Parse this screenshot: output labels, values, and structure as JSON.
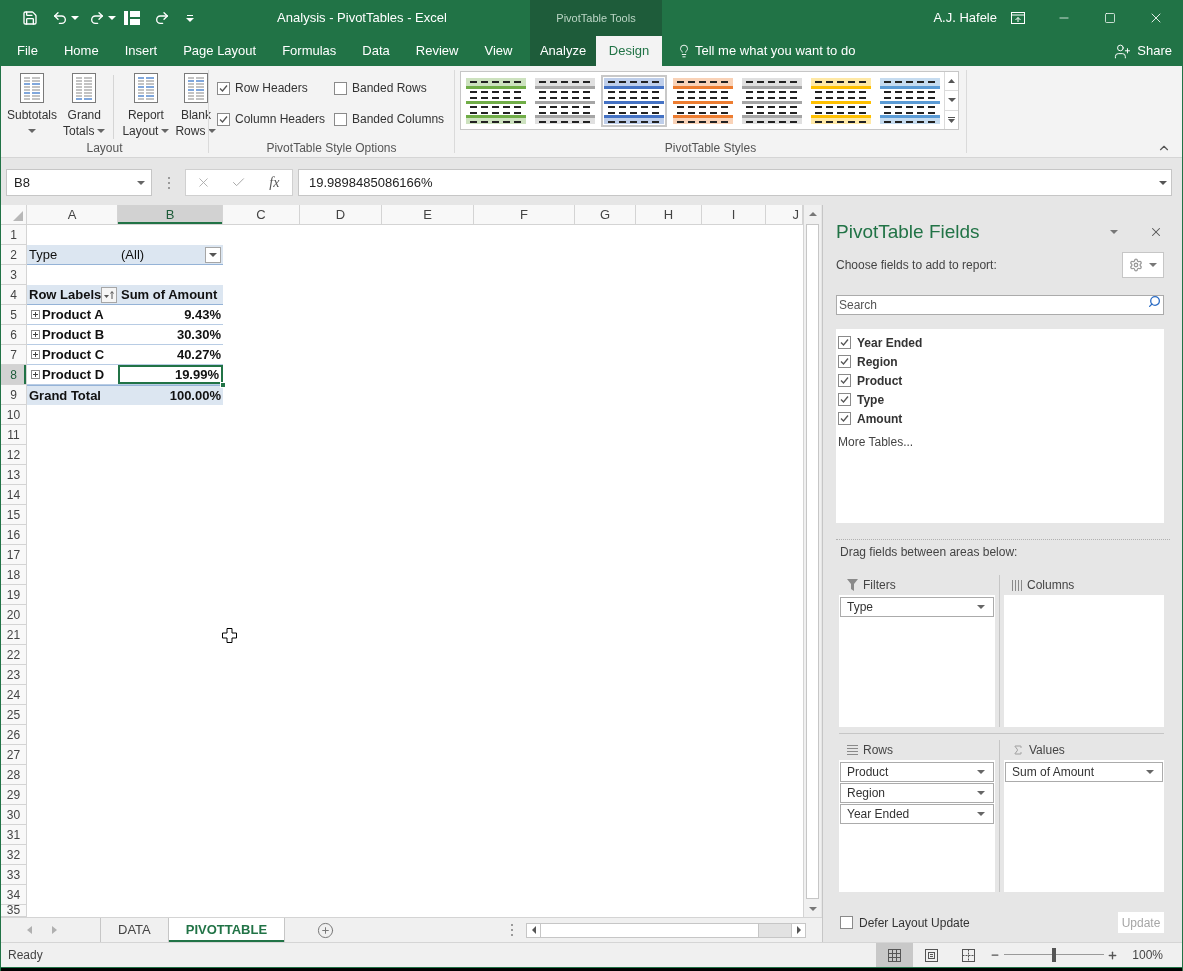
{
  "title_bar": {
    "title": "Analysis - PivotTables - Excel",
    "context_label": "PivotTable Tools",
    "user": "A.J. Hafele"
  },
  "ribbon_tabs": [
    {
      "label": "File",
      "context": false,
      "selected": false
    },
    {
      "label": "Home",
      "context": false,
      "selected": false
    },
    {
      "label": "Insert",
      "context": false,
      "selected": false
    },
    {
      "label": "Page Layout",
      "context": false,
      "selected": false
    },
    {
      "label": "Formulas",
      "context": false,
      "selected": false
    },
    {
      "label": "Data",
      "context": false,
      "selected": false
    },
    {
      "label": "Review",
      "context": false,
      "selected": false
    },
    {
      "label": "View",
      "context": false,
      "selected": false
    },
    {
      "label": "Analyze",
      "context": true,
      "selected": false
    },
    {
      "label": "Design",
      "context": true,
      "selected": true
    }
  ],
  "tell_me": {
    "placeholder": "Tell me what you want to do"
  },
  "share": {
    "label": "Share"
  },
  "ribbon": {
    "layout_group": {
      "label": "Layout",
      "button_sets": [
        [
          {
            "kind": "subtotals",
            "lines": [
              "Subtotals"
            ],
            "menu": true
          },
          {
            "kind": "grand_totals",
            "lines": [
              "Grand",
              "Totals"
            ],
            "menu": true
          }
        ],
        [
          {
            "kind": "report_layout",
            "lines": [
              "Report",
              "Layout"
            ],
            "menu": true
          },
          {
            "kind": "blank_rows",
            "lines": [
              "Blank",
              "Rows"
            ],
            "menu": true
          }
        ]
      ]
    },
    "style_options_group": {
      "label": "PivotTable Style Options",
      "options": [
        {
          "label": "Row Headers",
          "checked": true
        },
        {
          "label": "Banded Rows",
          "checked": false
        },
        {
          "label": "Column Headers",
          "checked": true
        },
        {
          "label": "Banded Columns",
          "checked": false
        }
      ]
    },
    "styles_group": {
      "label": "PivotTable Styles",
      "styles": [
        {
          "color": "#70ad47",
          "selected": false
        },
        {
          "color": "#a5a5a5",
          "selected": false
        },
        {
          "color": "#4472c4",
          "selected": true
        },
        {
          "color": "#ed7d31",
          "selected": false
        },
        {
          "color": "#a5a5a5",
          "selected": false
        },
        {
          "color": "#ffc000",
          "selected": false
        },
        {
          "color": "#5b9bd5",
          "selected": false
        }
      ]
    }
  },
  "formula_bar": {
    "name_box": "B8",
    "function_button": "fx",
    "formula": "19.9898485086166%"
  },
  "sheet": {
    "columns": [
      {
        "label": "A",
        "selected": false
      },
      {
        "label": "B",
        "selected": true
      },
      {
        "label": "C",
        "selected": false
      },
      {
        "label": "D",
        "selected": false
      },
      {
        "label": "E",
        "selected": false
      },
      {
        "label": "F",
        "selected": false
      },
      {
        "label": "G",
        "selected": false
      },
      {
        "label": "H",
        "selected": false
      },
      {
        "label": "I",
        "selected": false
      },
      {
        "label": "J",
        "selected": false
      }
    ],
    "rows": [
      {
        "label": "1",
        "selected": false
      },
      {
        "label": "2",
        "selected": false
      },
      {
        "label": "3",
        "selected": false
      },
      {
        "label": "4",
        "selected": false
      },
      {
        "label": "5",
        "selected": false
      },
      {
        "label": "6",
        "selected": false
      },
      {
        "label": "7",
        "selected": false
      },
      {
        "label": "8",
        "selected": true
      },
      {
        "label": "9",
        "selected": false
      },
      {
        "label": "10",
        "selected": false
      },
      {
        "label": "11",
        "selected": false
      },
      {
        "label": "12",
        "selected": false
      },
      {
        "label": "13",
        "selected": false
      },
      {
        "label": "14",
        "selected": false
      },
      {
        "label": "15",
        "selected": false
      },
      {
        "label": "16",
        "selected": false
      },
      {
        "label": "17",
        "selected": false
      },
      {
        "label": "18",
        "selected": false
      },
      {
        "label": "19",
        "selected": false
      },
      {
        "label": "20",
        "selected": false
      },
      {
        "label": "21",
        "selected": false
      },
      {
        "label": "22",
        "selected": false
      },
      {
        "label": "23",
        "selected": false
      },
      {
        "label": "24",
        "selected": false
      },
      {
        "label": "25",
        "selected": false
      },
      {
        "label": "26",
        "selected": false
      },
      {
        "label": "27",
        "selected": false
      },
      {
        "label": "28",
        "selected": false
      },
      {
        "label": "29",
        "selected": false
      },
      {
        "label": "30",
        "selected": false
      },
      {
        "label": "31",
        "selected": false
      },
      {
        "label": "32",
        "selected": false
      },
      {
        "label": "33",
        "selected": false
      },
      {
        "label": "34",
        "selected": false
      },
      {
        "label": "35",
        "selected": false
      }
    ],
    "pivot": {
      "filter": {
        "field": "Type",
        "value": "(All)"
      },
      "header": {
        "row_labels": "Row Labels",
        "value_field": "Sum of Amount"
      },
      "items": [
        {
          "label": "Product A",
          "value": "9.43%",
          "selected": false
        },
        {
          "label": "Product B",
          "value": "30.30%",
          "selected": false
        },
        {
          "label": "Product C",
          "value": "40.27%",
          "selected": false
        },
        {
          "label": "Product D",
          "value": "19.99%",
          "selected": true
        }
      ],
      "total": {
        "label": "Grand Total",
        "value": "100.00%"
      }
    }
  },
  "sheet_tabs": [
    {
      "label": "DATA",
      "selected": false
    },
    {
      "label": "PIVOTTABLE",
      "selected": true
    }
  ],
  "field_list": {
    "title": "PivotTable Fields",
    "subtitle": "Choose fields to add to report:",
    "search": {
      "placeholder": "Search"
    },
    "fields": [
      {
        "label": "Year Ended",
        "checked": true
      },
      {
        "label": "Region",
        "checked": true
      },
      {
        "label": "Product",
        "checked": true
      },
      {
        "label": "Type",
        "checked": true
      },
      {
        "label": "Amount",
        "checked": true
      }
    ],
    "more_tables": "More Tables...",
    "drag_hint": "Drag fields between areas below:",
    "areas": [
      {
        "kind": "filters",
        "label": "Filters",
        "items": [
          "Type"
        ]
      },
      {
        "kind": "columns",
        "label": "Columns"
      },
      {
        "kind": "rows",
        "label": "Rows",
        "items": [
          "Product",
          "Region",
          "Year Ended"
        ]
      },
      {
        "kind": "values",
        "label": "Values",
        "items": [
          "Sum of Amount"
        ]
      }
    ],
    "defer_update": {
      "label": "Defer Layout Update",
      "checked": false
    },
    "update_button": {
      "label": "Update",
      "disabled": true
    }
  },
  "status_bar": {
    "status": "Ready",
    "views": [
      {
        "kind": "normal",
        "selected": true
      },
      {
        "kind": "page_layout",
        "selected": false
      },
      {
        "kind": "page_break_preview",
        "selected": false
      }
    ],
    "zoom": {
      "level": 0.5,
      "reading": "100%"
    }
  }
}
